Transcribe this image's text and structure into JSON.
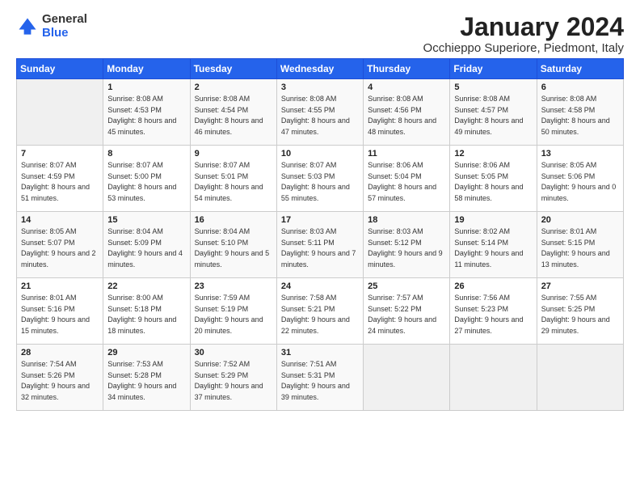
{
  "logo": {
    "general": "General",
    "blue": "Blue"
  },
  "header": {
    "title": "January 2024",
    "subtitle": "Occhieppo Superiore, Piedmont, Italy"
  },
  "weekdays": [
    "Sunday",
    "Monday",
    "Tuesday",
    "Wednesday",
    "Thursday",
    "Friday",
    "Saturday"
  ],
  "weeks": [
    [
      {
        "day": "",
        "sunrise": "",
        "sunset": "",
        "daylight": ""
      },
      {
        "day": "1",
        "sunrise": "Sunrise: 8:08 AM",
        "sunset": "Sunset: 4:53 PM",
        "daylight": "Daylight: 8 hours and 45 minutes."
      },
      {
        "day": "2",
        "sunrise": "Sunrise: 8:08 AM",
        "sunset": "Sunset: 4:54 PM",
        "daylight": "Daylight: 8 hours and 46 minutes."
      },
      {
        "day": "3",
        "sunrise": "Sunrise: 8:08 AM",
        "sunset": "Sunset: 4:55 PM",
        "daylight": "Daylight: 8 hours and 47 minutes."
      },
      {
        "day": "4",
        "sunrise": "Sunrise: 8:08 AM",
        "sunset": "Sunset: 4:56 PM",
        "daylight": "Daylight: 8 hours and 48 minutes."
      },
      {
        "day": "5",
        "sunrise": "Sunrise: 8:08 AM",
        "sunset": "Sunset: 4:57 PM",
        "daylight": "Daylight: 8 hours and 49 minutes."
      },
      {
        "day": "6",
        "sunrise": "Sunrise: 8:08 AM",
        "sunset": "Sunset: 4:58 PM",
        "daylight": "Daylight: 8 hours and 50 minutes."
      }
    ],
    [
      {
        "day": "7",
        "sunrise": "Sunrise: 8:07 AM",
        "sunset": "Sunset: 4:59 PM",
        "daylight": "Daylight: 8 hours and 51 minutes."
      },
      {
        "day": "8",
        "sunrise": "Sunrise: 8:07 AM",
        "sunset": "Sunset: 5:00 PM",
        "daylight": "Daylight: 8 hours and 53 minutes."
      },
      {
        "day": "9",
        "sunrise": "Sunrise: 8:07 AM",
        "sunset": "Sunset: 5:01 PM",
        "daylight": "Daylight: 8 hours and 54 minutes."
      },
      {
        "day": "10",
        "sunrise": "Sunrise: 8:07 AM",
        "sunset": "Sunset: 5:03 PM",
        "daylight": "Daylight: 8 hours and 55 minutes."
      },
      {
        "day": "11",
        "sunrise": "Sunrise: 8:06 AM",
        "sunset": "Sunset: 5:04 PM",
        "daylight": "Daylight: 8 hours and 57 minutes."
      },
      {
        "day": "12",
        "sunrise": "Sunrise: 8:06 AM",
        "sunset": "Sunset: 5:05 PM",
        "daylight": "Daylight: 8 hours and 58 minutes."
      },
      {
        "day": "13",
        "sunrise": "Sunrise: 8:05 AM",
        "sunset": "Sunset: 5:06 PM",
        "daylight": "Daylight: 9 hours and 0 minutes."
      }
    ],
    [
      {
        "day": "14",
        "sunrise": "Sunrise: 8:05 AM",
        "sunset": "Sunset: 5:07 PM",
        "daylight": "Daylight: 9 hours and 2 minutes."
      },
      {
        "day": "15",
        "sunrise": "Sunrise: 8:04 AM",
        "sunset": "Sunset: 5:09 PM",
        "daylight": "Daylight: 9 hours and 4 minutes."
      },
      {
        "day": "16",
        "sunrise": "Sunrise: 8:04 AM",
        "sunset": "Sunset: 5:10 PM",
        "daylight": "Daylight: 9 hours and 5 minutes."
      },
      {
        "day": "17",
        "sunrise": "Sunrise: 8:03 AM",
        "sunset": "Sunset: 5:11 PM",
        "daylight": "Daylight: 9 hours and 7 minutes."
      },
      {
        "day": "18",
        "sunrise": "Sunrise: 8:03 AM",
        "sunset": "Sunset: 5:12 PM",
        "daylight": "Daylight: 9 hours and 9 minutes."
      },
      {
        "day": "19",
        "sunrise": "Sunrise: 8:02 AM",
        "sunset": "Sunset: 5:14 PM",
        "daylight": "Daylight: 9 hours and 11 minutes."
      },
      {
        "day": "20",
        "sunrise": "Sunrise: 8:01 AM",
        "sunset": "Sunset: 5:15 PM",
        "daylight": "Daylight: 9 hours and 13 minutes."
      }
    ],
    [
      {
        "day": "21",
        "sunrise": "Sunrise: 8:01 AM",
        "sunset": "Sunset: 5:16 PM",
        "daylight": "Daylight: 9 hours and 15 minutes."
      },
      {
        "day": "22",
        "sunrise": "Sunrise: 8:00 AM",
        "sunset": "Sunset: 5:18 PM",
        "daylight": "Daylight: 9 hours and 18 minutes."
      },
      {
        "day": "23",
        "sunrise": "Sunrise: 7:59 AM",
        "sunset": "Sunset: 5:19 PM",
        "daylight": "Daylight: 9 hours and 20 minutes."
      },
      {
        "day": "24",
        "sunrise": "Sunrise: 7:58 AM",
        "sunset": "Sunset: 5:21 PM",
        "daylight": "Daylight: 9 hours and 22 minutes."
      },
      {
        "day": "25",
        "sunrise": "Sunrise: 7:57 AM",
        "sunset": "Sunset: 5:22 PM",
        "daylight": "Daylight: 9 hours and 24 minutes."
      },
      {
        "day": "26",
        "sunrise": "Sunrise: 7:56 AM",
        "sunset": "Sunset: 5:23 PM",
        "daylight": "Daylight: 9 hours and 27 minutes."
      },
      {
        "day": "27",
        "sunrise": "Sunrise: 7:55 AM",
        "sunset": "Sunset: 5:25 PM",
        "daylight": "Daylight: 9 hours and 29 minutes."
      }
    ],
    [
      {
        "day": "28",
        "sunrise": "Sunrise: 7:54 AM",
        "sunset": "Sunset: 5:26 PM",
        "daylight": "Daylight: 9 hours and 32 minutes."
      },
      {
        "day": "29",
        "sunrise": "Sunrise: 7:53 AM",
        "sunset": "Sunset: 5:28 PM",
        "daylight": "Daylight: 9 hours and 34 minutes."
      },
      {
        "day": "30",
        "sunrise": "Sunrise: 7:52 AM",
        "sunset": "Sunset: 5:29 PM",
        "daylight": "Daylight: 9 hours and 37 minutes."
      },
      {
        "day": "31",
        "sunrise": "Sunrise: 7:51 AM",
        "sunset": "Sunset: 5:31 PM",
        "daylight": "Daylight: 9 hours and 39 minutes."
      },
      {
        "day": "",
        "sunrise": "",
        "sunset": "",
        "daylight": ""
      },
      {
        "day": "",
        "sunrise": "",
        "sunset": "",
        "daylight": ""
      },
      {
        "day": "",
        "sunrise": "",
        "sunset": "",
        "daylight": ""
      }
    ]
  ]
}
